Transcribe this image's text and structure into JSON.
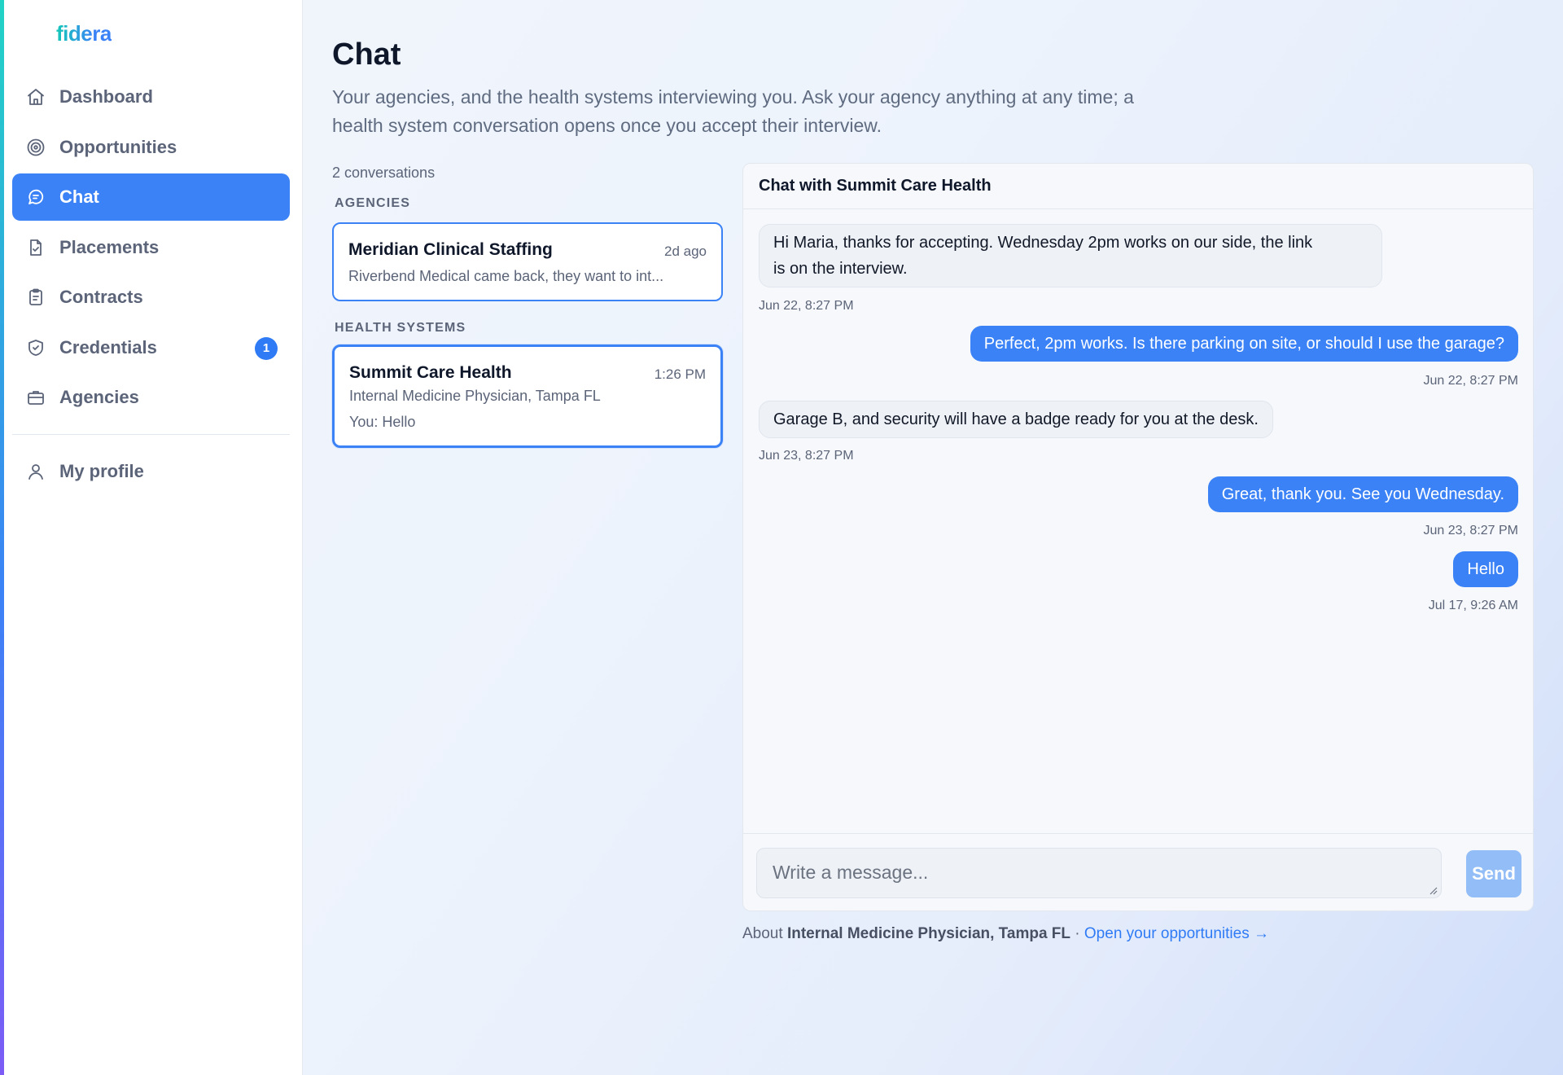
{
  "brand": {
    "logo": "fidera"
  },
  "sidebar": {
    "items": [
      {
        "label": "Dashboard",
        "icon": "home-icon"
      },
      {
        "label": "Opportunities",
        "icon": "target-icon"
      },
      {
        "label": "Chat",
        "icon": "chat-icon",
        "active": true
      },
      {
        "label": "Placements",
        "icon": "file-check-icon"
      },
      {
        "label": "Contracts",
        "icon": "clipboard-icon"
      },
      {
        "label": "Credentials",
        "icon": "shield-check-icon",
        "badge": "1"
      },
      {
        "label": "Agencies",
        "icon": "briefcase-icon"
      }
    ],
    "profile": {
      "label": "My profile",
      "icon": "user-icon"
    }
  },
  "page": {
    "title": "Chat",
    "subtitle": "Your agencies, and the health systems interviewing you. Ask your agency anything at any time; a health system conversation opens once you accept their interview."
  },
  "conversations": {
    "count_label": "2 conversations",
    "agencies_label": "AGENCIES",
    "health_systems_label": "HEALTH SYSTEMS",
    "agency": {
      "name": "Meridian Clinical Staffing",
      "time": "2d ago",
      "preview": "Riverbend Medical came back, they want to int..."
    },
    "health_system": {
      "name": "Summit Care Health",
      "time": "1:26 PM",
      "role": "Internal Medicine Physician, Tampa FL",
      "preview": "You: Hello"
    }
  },
  "chat": {
    "header": "Chat with Summit Care Health",
    "messages": [
      {
        "direction": "in",
        "text_line1": "Hi Maria, thanks for accepting. Wednesday 2pm works on our side, the link",
        "text_line2": "is on the interview.",
        "time": "Jun 22, 8:27 PM"
      },
      {
        "direction": "out",
        "text": "Perfect, 2pm works. Is there parking on site, or should I use the garage?",
        "time": "Jun 22, 8:27 PM"
      },
      {
        "direction": "in",
        "text": "Garage B, and security will have a badge ready for you at the desk.",
        "time": "Jun 23, 8:27 PM"
      },
      {
        "direction": "out",
        "text": "Great, thank you. See you Wednesday.",
        "time": "Jun 23, 8:27 PM"
      },
      {
        "direction": "out",
        "text": "Hello",
        "time": "Jul 17, 9:26 AM"
      }
    ],
    "composer_placeholder": "Write a message...",
    "send_label": "Send"
  },
  "footer": {
    "about_prefix": "About",
    "about_role": "Internal Medicine Physician, Tampa FL",
    "separator": "·",
    "link_label": "Open your opportunities →"
  },
  "colors": {
    "accent": "#3b82f6",
    "send_disabled": "#93bdf7",
    "badge": "#2f7bf5"
  }
}
